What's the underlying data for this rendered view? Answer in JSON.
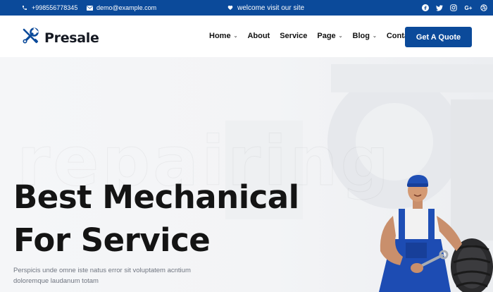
{
  "topbar": {
    "phone": "+998556778345",
    "email": "demo@example.com",
    "welcome": "welcome visit our site",
    "social_icons": [
      "facebook-icon",
      "twitter-icon",
      "instagram-icon",
      "google-plus-icon",
      "dribbble-icon"
    ],
    "bg_color": "#0b4a9a"
  },
  "header": {
    "logo_text": "Presale",
    "nav": [
      {
        "label": "Home",
        "has_dropdown": true
      },
      {
        "label": "About",
        "has_dropdown": false
      },
      {
        "label": "Service",
        "has_dropdown": false
      },
      {
        "label": "Page",
        "has_dropdown": true
      },
      {
        "label": "Blog",
        "has_dropdown": true
      },
      {
        "label": "Contact",
        "has_dropdown": false
      }
    ],
    "cta_label": "Get A Quote",
    "accent_color": "#0b4a9a"
  },
  "hero": {
    "watermark": "repairing",
    "title_line1": "Best Mechanical",
    "title_line2": "For Service",
    "description": "Perspicis unde omne iste natus error sit voluptatem acntium doloremque laudanum totam"
  }
}
